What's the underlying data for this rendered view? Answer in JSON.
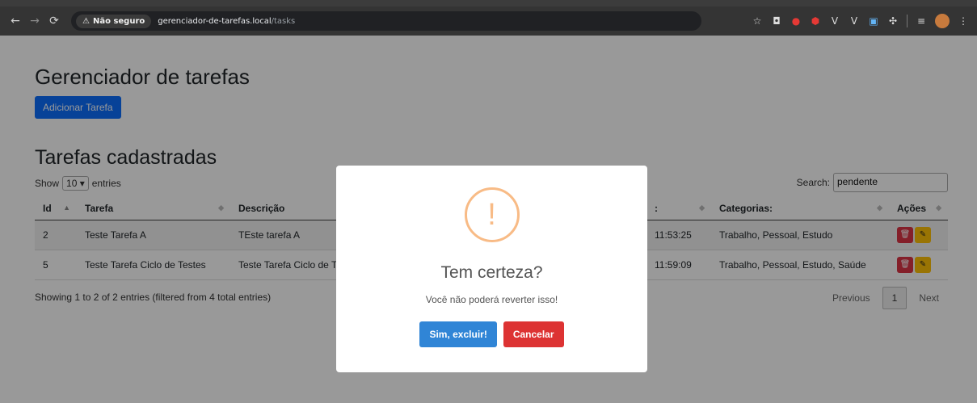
{
  "browser": {
    "security_label": "Não seguro",
    "url_host": "gerenciador-de-tarefas.local",
    "url_path": "/tasks",
    "extensions": [
      "camera-icon",
      "rec-icon",
      "adblock-icon",
      "v-icon",
      "v-icon",
      "translate-icon",
      "puzzle-icon",
      "playlist-icon",
      "profile-icon",
      "menu-icon"
    ]
  },
  "page": {
    "title": "Gerenciador de tarefas",
    "add_button": "Adicionar Tarefa",
    "list_title": "Tarefas cadastradas"
  },
  "datatable": {
    "show_label": "Show",
    "length_value": "10",
    "entries_label": "entries",
    "search_label": "Search:",
    "search_value": "pendente",
    "columns": [
      "Id",
      "Tarefa",
      "Descrição",
      ":",
      "Categorias:",
      "Ações"
    ],
    "rows": [
      {
        "id": "2",
        "tarefa": "Teste Tarefa A",
        "descricao": "TEste tarefa A",
        "data": "11:53:25",
        "categorias": "Trabalho, Pessoal, Estudo"
      },
      {
        "id": "5",
        "tarefa": "Teste Tarefa Ciclo de Testes",
        "descricao": "Teste Tarefa Ciclo de Teste",
        "data": "11:59:09",
        "categorias": "Trabalho, Pessoal, Estudo, Saúde"
      }
    ],
    "info": "Showing 1 to 2 of 2 entries (filtered from 4 total entries)",
    "pagination": {
      "previous": "Previous",
      "current": "1",
      "next": "Next"
    }
  },
  "modal": {
    "icon": "!",
    "title": "Tem certeza?",
    "text": "Você não poderá reverter isso!",
    "confirm": "Sim, excluir!",
    "cancel": "Cancelar"
  },
  "colors": {
    "primary": "#0d6efd",
    "confirm": "#3085d6",
    "cancel": "#dd3333",
    "warning_icon": "#f8bb86"
  }
}
